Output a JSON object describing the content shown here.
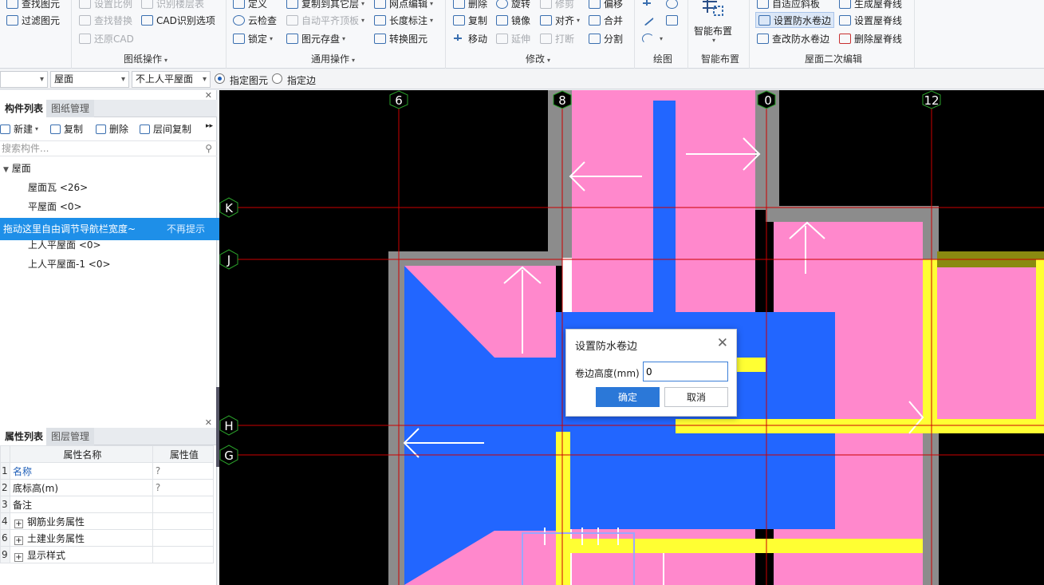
{
  "ribbon": {
    "g1": {
      "item1": "查找图元",
      "item2": "过滤图元"
    },
    "g2": {
      "item1": "设置比例",
      "item2": "识别楼层表",
      "item3": "查找替换",
      "item4": "CAD识别选项",
      "item5": "还原CAD",
      "label": "图纸操作"
    },
    "g3": {
      "item1": "定义",
      "item2": "复制到其它层",
      "item3": "网点编辑",
      "item4": "云检查",
      "item5": "自动平齐顶板",
      "item6": "长度标注",
      "item7": "锁定",
      "item8": "图元存盘",
      "item9": "转换图元",
      "label": "通用操作"
    },
    "g4": {
      "item1": "删除",
      "item2": "旋转",
      "item3": "修剪",
      "item4": "偏移",
      "item5": "复制",
      "item6": "镜像",
      "item7": "对齐",
      "item8": "合并",
      "item9": "移动",
      "item10": "延伸",
      "item11": "打断",
      "item12": "分割",
      "label": "修改"
    },
    "g5": {
      "label": "绘图"
    },
    "g6": {
      "big": "智能布置",
      "label": "智能布置"
    },
    "g7": {
      "item1": "自适应斜板",
      "item2": "生成屋脊线",
      "item3": "设置防水卷边",
      "item4": "设置屋脊线",
      "item5": "查改防水卷边",
      "item6": "删除屋脊线",
      "label": "屋面二次编辑"
    }
  },
  "subbar": {
    "sel1": "",
    "sel2": "屋面",
    "sel3": "不上人平屋面",
    "radio1": "指定图元",
    "radio2": "指定边"
  },
  "left": {
    "tab1": "构件列表",
    "tab2": "图纸管理",
    "new": "新建",
    "copy": "复制",
    "delete": "删除",
    "layercopy": "层间复制",
    "search_placeholder": "搜索构件...",
    "tree": {
      "root": "屋面",
      "i1": "屋面瓦 <26>",
      "i2": "平屋面 <0>",
      "i3": "上人平屋面 <0>",
      "i4": "上人平屋面-1 <0>"
    },
    "tip": "拖动这里自由调节导航栏宽度~",
    "tip_dismiss": "不再提示",
    "ptab1": "属性列表",
    "ptab2": "图层管理",
    "col1": "属性名称",
    "col2": "属性值",
    "rows": [
      {
        "n": "1",
        "name": "名称",
        "val": "?"
      },
      {
        "n": "2",
        "name": "底标高(m)",
        "val": "?"
      },
      {
        "n": "3",
        "name": "备注",
        "val": ""
      },
      {
        "n": "4",
        "name": "钢筋业务属性",
        "val": ""
      },
      {
        "n": "6",
        "name": "土建业务属性",
        "val": ""
      },
      {
        "n": "9",
        "name": "显示样式",
        "val": ""
      }
    ]
  },
  "axes": {
    "x6": "6",
    "x8": "8",
    "x10": "0",
    "x12": "12",
    "K": "K",
    "J": "J",
    "H": "H",
    "G": "G"
  },
  "dialog": {
    "title": "设置防水卷边",
    "field_label": "卷边高度(mm)",
    "field_value": "0",
    "ok": "确定",
    "cancel": "取消"
  },
  "colors": {
    "pink": "#ff88cc",
    "blue": "#2266ff",
    "yellow": "#ffff33",
    "grey": "#8c8c8c",
    "axis": "#cc0000"
  }
}
